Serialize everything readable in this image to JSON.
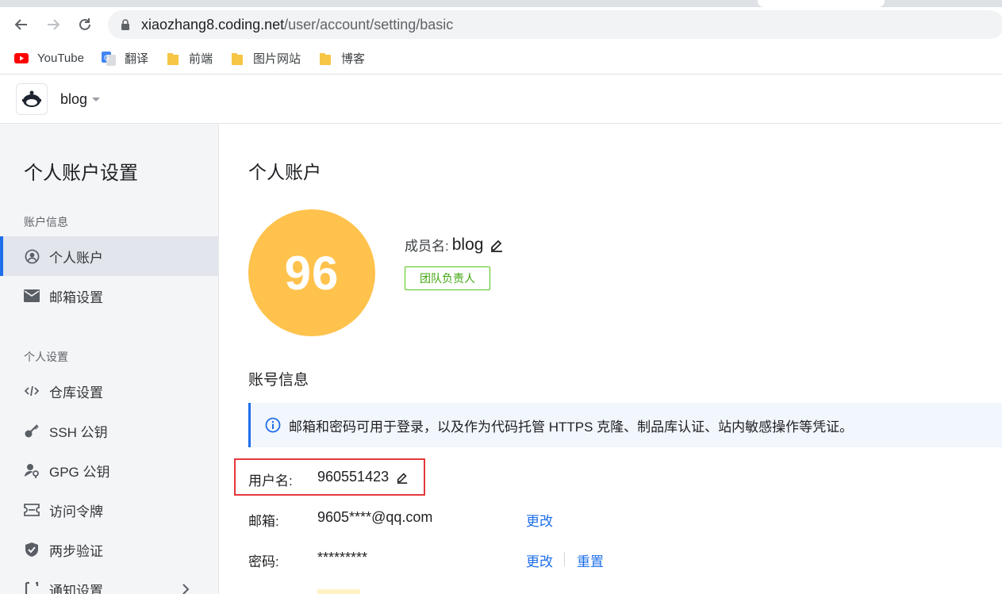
{
  "browser": {
    "url_domain": "xiaozhang8.coding.net",
    "url_path": "/user/account/setting/basic",
    "bookmarks": [
      {
        "label": "YouTube",
        "icon": "youtube-icon"
      },
      {
        "label": "翻译",
        "icon": "google-translate-icon"
      },
      {
        "label": "前端",
        "icon": "folder-icon"
      },
      {
        "label": "图片网站",
        "icon": "folder-icon"
      },
      {
        "label": "博客",
        "icon": "folder-icon"
      }
    ]
  },
  "header": {
    "team_name": "blog"
  },
  "sidebar": {
    "title": "个人账户设置",
    "sections": [
      {
        "label": "账户信息"
      },
      {
        "label": "个人设置"
      }
    ],
    "items": [
      {
        "label": "个人账户",
        "icon": "user-circle-icon",
        "active": true
      },
      {
        "label": "邮箱设置",
        "icon": "envelope-icon"
      },
      {
        "label": "仓库设置",
        "icon": "code-icon"
      },
      {
        "label": "SSH 公钥",
        "icon": "key-icon"
      },
      {
        "label": "GPG 公钥",
        "icon": "user-key-icon"
      },
      {
        "label": "访问令牌",
        "icon": "ticket-icon"
      },
      {
        "label": "两步验证",
        "icon": "shield-check-icon"
      },
      {
        "label": "通知设置",
        "icon": "bell-icon"
      }
    ]
  },
  "main": {
    "title": "个人账户",
    "avatar_text": "96",
    "avatar_color": "#ffc24d",
    "member_label": "成员名:",
    "member_name": "blog",
    "role_badge": "团队负责人",
    "account_heading": "账号信息",
    "notice": "邮箱和密码可用于登录，以及作为代码托管 HTTPS 克隆、制品库认证、站内敏感操作等凭证。",
    "fields": {
      "username": {
        "label": "用户名:",
        "value": "960551423"
      },
      "email": {
        "label": "邮箱:",
        "value": "9605****@qq.com",
        "action": "更改"
      },
      "password": {
        "label": "密码:",
        "value": "*********",
        "action_change": "更改",
        "action_reset": "重置"
      }
    }
  },
  "colors": {
    "accent": "#1f6feb",
    "highlight": "#e5383b",
    "badge_green": "#52c41a"
  }
}
